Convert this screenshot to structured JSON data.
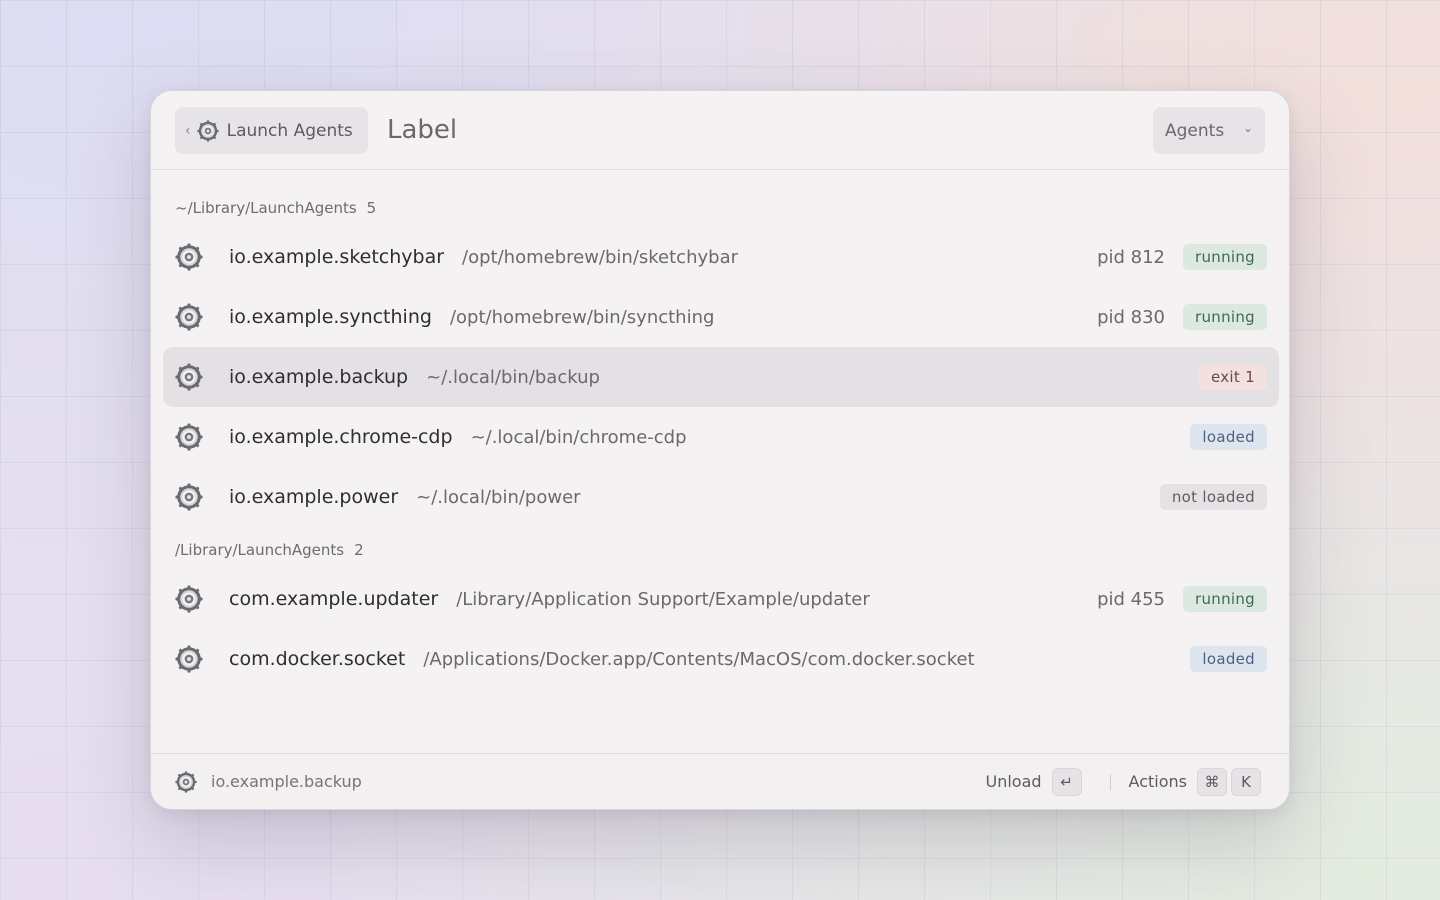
{
  "header": {
    "back_label": "Launch Agents",
    "title": "Label",
    "filter_selected": "Agents"
  },
  "sections": [
    {
      "path": "~/Library/LaunchAgents",
      "count": "5",
      "items": [
        {
          "label": "io.example.sketchybar",
          "path": "/opt/homebrew/bin/sketchybar",
          "pid": "pid 812",
          "status": "running"
        },
        {
          "label": "io.example.syncthing",
          "path": "/opt/homebrew/bin/syncthing",
          "pid": "pid 830",
          "status": "running"
        },
        {
          "label": "io.example.backup",
          "path": "~/.local/bin/backup",
          "pid": "",
          "status": "exit 1"
        },
        {
          "label": "io.example.chrome-cdp",
          "path": "~/.local/bin/chrome-cdp",
          "pid": "",
          "status": "loaded"
        },
        {
          "label": "io.example.power",
          "path": "~/.local/bin/power",
          "pid": "",
          "status": "not loaded"
        }
      ]
    },
    {
      "path": "/Library/LaunchAgents",
      "count": "2",
      "items": [
        {
          "label": "com.example.updater",
          "path": "/Library/Application Support/Example/updater",
          "pid": "pid 455",
          "status": "running"
        },
        {
          "label": "com.docker.socket",
          "path": "/Applications/Docker.app/Contents/MacOS/com.docker.socket",
          "pid": "",
          "status": "loaded"
        }
      ]
    }
  ],
  "footer": {
    "selected_label": "io.example.backup",
    "primary_action": "Unload",
    "primary_key": "↵",
    "actions_label": "Actions",
    "actions_keys": [
      "⌘",
      "K"
    ]
  },
  "colors": {
    "running_bg": "#dbe9e1",
    "loaded_bg": "#dde5ee",
    "exit_bg": "#f3e1e1",
    "not_loaded_bg": "#e5e2e5"
  },
  "icons": {
    "item": "gear-icon",
    "back": "chevron-left-icon",
    "dropdown": "chevron-down-icon"
  }
}
